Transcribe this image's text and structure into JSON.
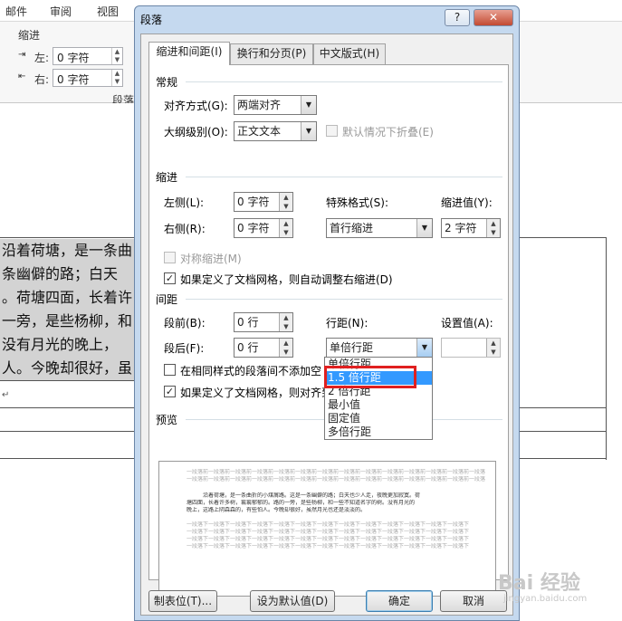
{
  "ribbon": {
    "tabs": [
      "邮件",
      "审阅",
      "视图"
    ],
    "indent_label": "缩进",
    "left_label": "左:",
    "right_label": "右:",
    "left_value": "0 字符",
    "right_value": "0 字符",
    "group_label": "段落"
  },
  "document": {
    "lines": [
      "沿着荷塘，是一条曲",
      "条幽僻的路；白天",
      "。荷塘四面，长着许",
      "一旁，是些杨柳，和",
      "没有月光的晚上，",
      "人。今晚却很好，虽"
    ]
  },
  "dialog": {
    "title": "段落",
    "help_btn": "?",
    "close_btn": "✕",
    "tabs": [
      "缩进和间距(I)",
      "换行和分页(P)",
      "中文版式(H)"
    ],
    "general": {
      "section": "常规",
      "align_label": "对齐方式(G):",
      "align_value": "两端对齐",
      "outline_label": "大纲级别(O):",
      "outline_value": "正文文本",
      "collapse_label": "默认情况下折叠(E)"
    },
    "indent": {
      "section": "缩进",
      "left_label": "左侧(L):",
      "left_value": "0 字符",
      "right_label": "右侧(R):",
      "right_value": "0 字符",
      "special_label": "特殊格式(S):",
      "special_value": "首行缩进",
      "by_label": "缩进值(Y):",
      "by_value": "2 字符",
      "mirror_label": "对称缩进(M)",
      "grid_label": "如果定义了文档网格，则自动调整右缩进(D)"
    },
    "spacing": {
      "section": "间距",
      "before_label": "段前(B):",
      "before_value": "0 行",
      "after_label": "段后(F):",
      "after_value": "0 行",
      "line_label": "行距(N):",
      "line_value": "单倍行距",
      "at_label": "设置值(A):",
      "at_value": "",
      "same_style_label": "在相同样式的段落间不添加空",
      "snap_grid_label": "如果定义了文档网格，则对齐到"
    },
    "dropdown_options": [
      "单倍行距",
      "1.5 倍行距",
      "2 倍行距",
      "最小值",
      "固定值",
      "多倍行距"
    ],
    "dropdown_selected": "1.5 倍行距",
    "preview": {
      "section": "预览",
      "prev_text": "一段落前一段落前一段落前一段落前一段落前一段落前一段落前一段落前一段落前一段落前一段落前一段落前一段落前一段落前",
      "sample_1": "沿着荷塘，是一条曲折的小煤屑路。这是一条幽僻的路；白天也少人走，夜晚更加寂寞。荷",
      "sample_2": "塘四面，长着许多树，蓊蓊郁郁的。路的一旁，是些杨柳，和一些不知道名字的树。没有月光的",
      "sample_3": "晚上，这路上阴森森的，有些怕人。今晚却很好，虽然月光也还是淡淡的。",
      "next_text": "一段落下一段落下一段落下一段落下一段落下一段落下一段落下一段落下一段落下一段落下一段落下一段落下一段落下"
    },
    "buttons": {
      "tabs": "制表位(T)...",
      "default": "设为默认值(D)",
      "ok": "确定",
      "cancel": "取消"
    }
  },
  "watermark": {
    "main": "Bai 经验",
    "sub": "jingyan.baidu.com"
  }
}
